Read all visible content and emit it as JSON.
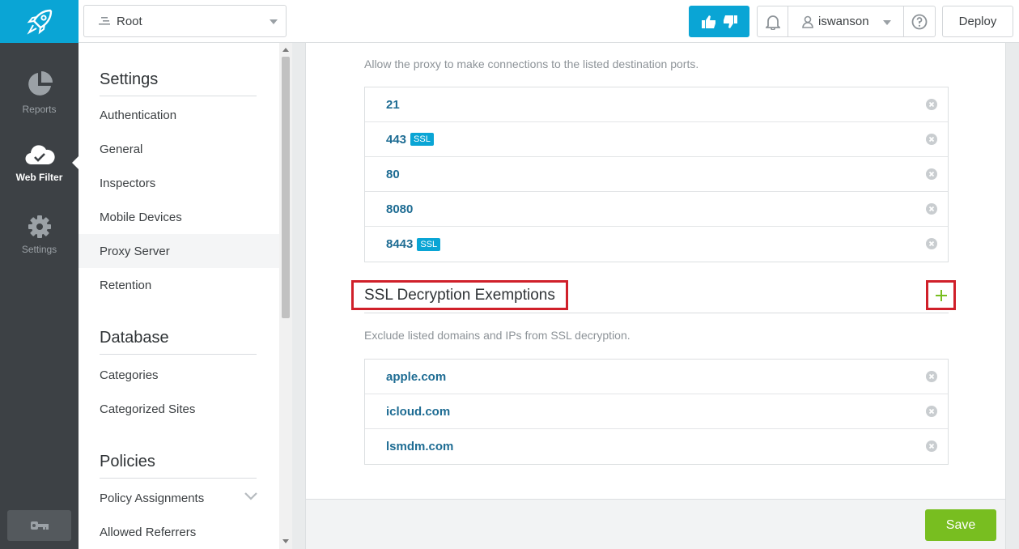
{
  "rail": {
    "items": [
      {
        "label": "Reports"
      },
      {
        "label": "Web Filter"
      },
      {
        "label": "Settings"
      }
    ]
  },
  "topbar": {
    "root_label": "Root",
    "username": "iswanson",
    "deploy_label": "Deploy"
  },
  "sidebar": {
    "sections": [
      {
        "title": "Settings",
        "items": [
          "Authentication",
          "General",
          "Inspectors",
          "Mobile Devices",
          "Proxy Server",
          "Retention"
        ]
      },
      {
        "title": "Database",
        "items": [
          "Categories",
          "Categorized Sites"
        ]
      },
      {
        "title": "Policies",
        "items": [
          "Policy Assignments",
          "Allowed Referrers"
        ]
      }
    ],
    "active_item": "Proxy Server"
  },
  "ports": {
    "description": "Allow the proxy to make connections to the listed destination ports.",
    "rows": [
      {
        "value": "21",
        "badge": ""
      },
      {
        "value": "443",
        "badge": "SSL"
      },
      {
        "value": "80",
        "badge": ""
      },
      {
        "value": "8080",
        "badge": ""
      },
      {
        "value": "8443",
        "badge": "SSL"
      }
    ]
  },
  "ssl_exemptions": {
    "title": "SSL Decryption Exemptions",
    "description": "Exclude listed domains and IPs from SSL decryption.",
    "rows": [
      "apple.com",
      "icloud.com",
      "lsmdm.com"
    ]
  },
  "footer": {
    "save_label": "Save"
  },
  "colors": {
    "brand": "#0aa5d5",
    "save": "#78be20",
    "highlight": "#d0202a",
    "link": "#1e6c93"
  }
}
